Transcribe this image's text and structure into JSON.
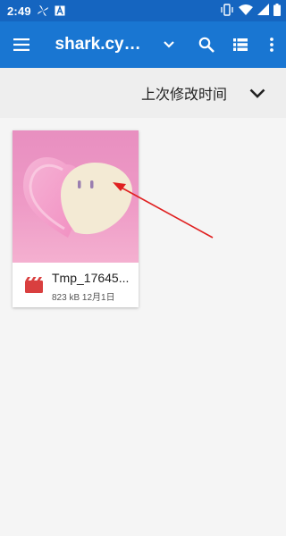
{
  "status_bar": {
    "time": "2:49",
    "icons": [
      "pinwheel-icon",
      "a-icon",
      "vibrate-icon",
      "wifi-icon",
      "signal-icon",
      "battery-icon"
    ]
  },
  "toolbar": {
    "title": "shark.cyhj...",
    "icons": [
      "menu-icon",
      "chevron-down-icon",
      "search-icon",
      "list-view-icon",
      "more-vert-icon"
    ]
  },
  "sort": {
    "label": "上次修改时间",
    "icon": "chevron-down-icon"
  },
  "files": [
    {
      "name": "Tmp_17645...",
      "size": "823 kB",
      "date": "12月1日",
      "type_icon": "video-icon"
    }
  ],
  "colors": {
    "status_bar": "#1565c0",
    "toolbar": "#1976d2",
    "background": "#f5f5f5",
    "sort_row": "#eeeeee",
    "video_icon": "#d93f3f",
    "annotation_arrow": "#e02020"
  }
}
